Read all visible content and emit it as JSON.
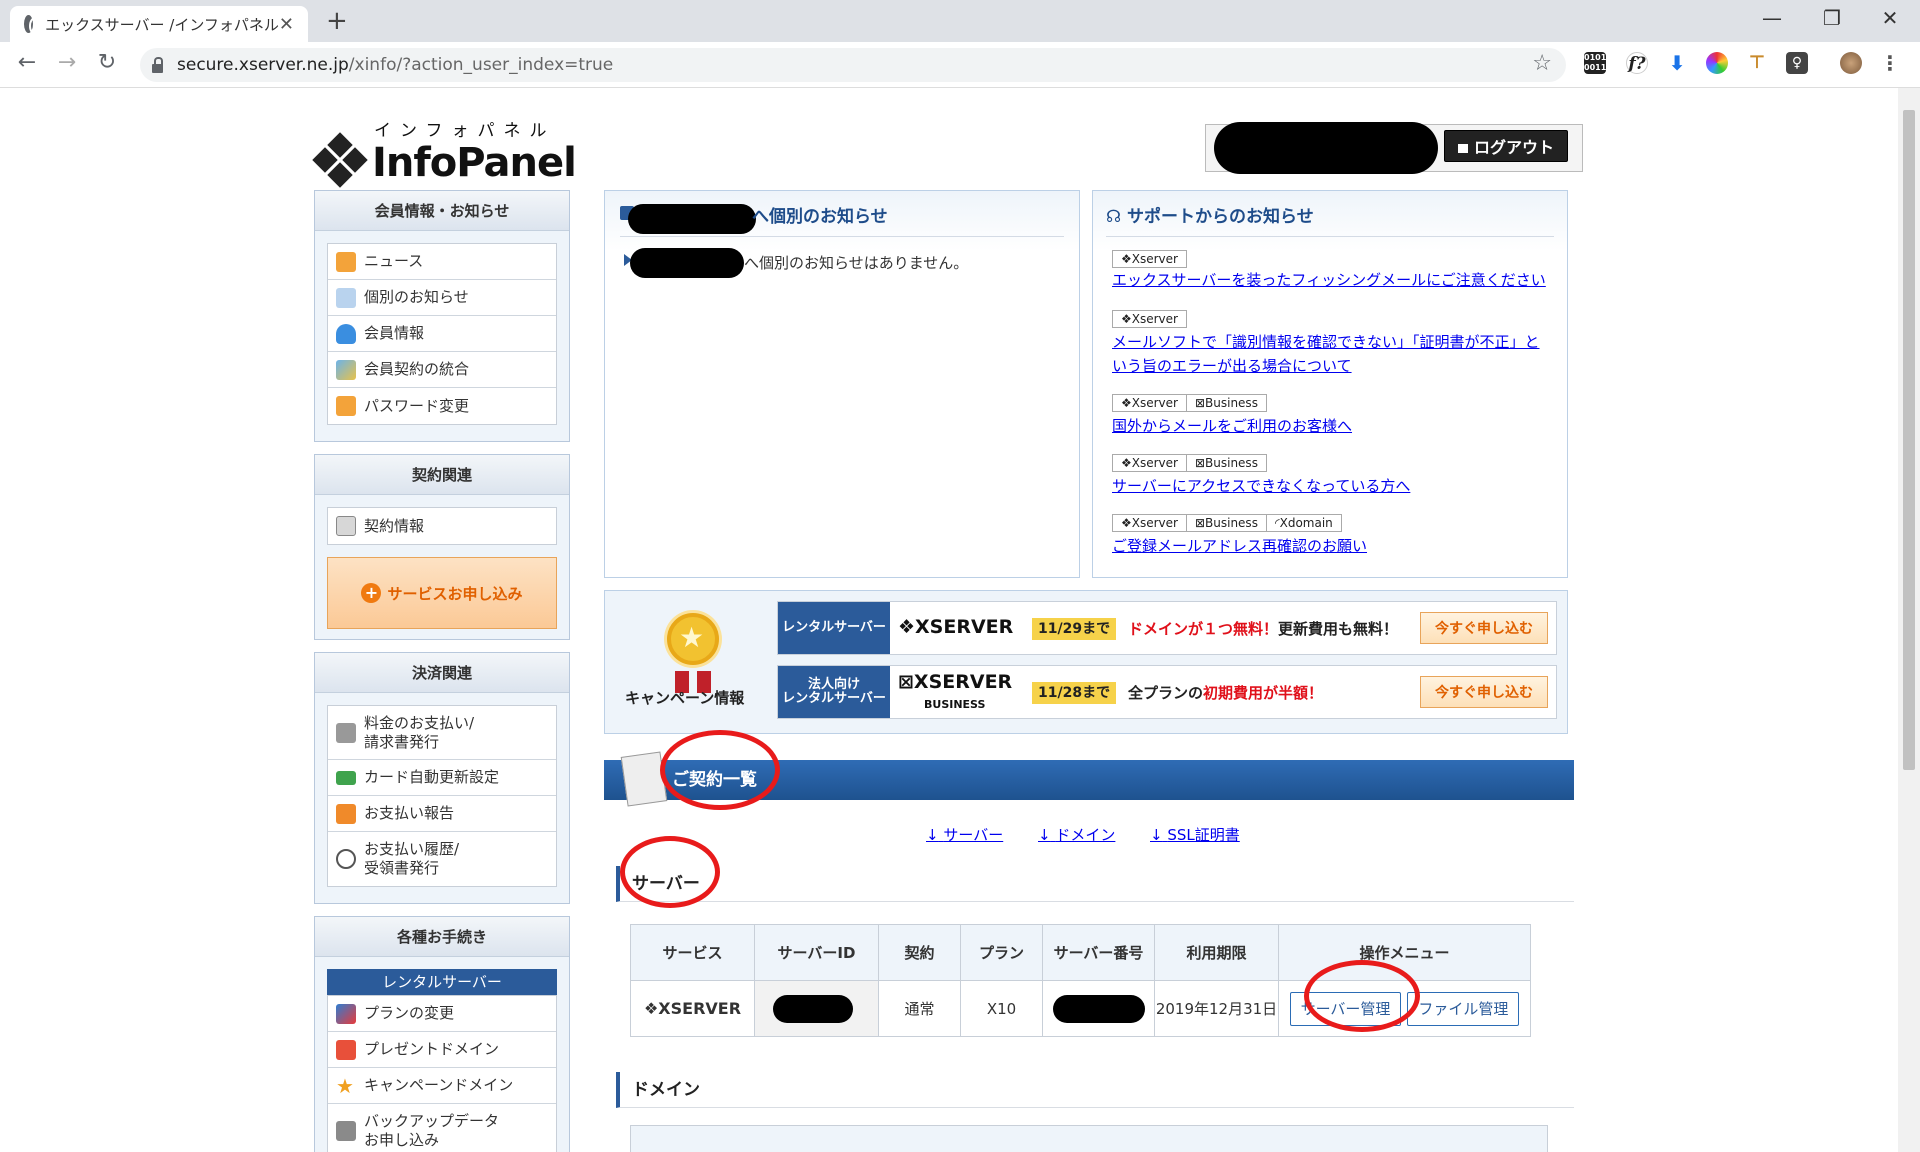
{
  "browser": {
    "tab_title": "エックスサーバー /インフォパネル",
    "tab_close": "✕",
    "new_tab": "+",
    "url_host": "secure.xserver.ne.jp",
    "url_path": "/xinfo/?action_user_index=true",
    "win_min": "—",
    "win_max": "❐",
    "win_close": "✕"
  },
  "header": {
    "logo_kana": "インフォパネル",
    "logo_text": "InfoPanel",
    "logout_label": "ログアウト"
  },
  "sidebar": {
    "member": {
      "title": "会員情報・お知らせ",
      "items": [
        "ニュース",
        "個別のお知らせ",
        "会員情報",
        "会員契約の統合",
        "パスワード変更"
      ]
    },
    "contract": {
      "title": "契約関連",
      "items": [
        "契約情報"
      ],
      "service_button": "サービスお申し込み"
    },
    "payment": {
      "title": "決済関連",
      "items": [
        "料金のお支払い/\n請求書発行",
        "カード自動更新設定",
        "お支払い報告",
        "お支払い履歴/\n受領書発行"
      ]
    },
    "procedures": {
      "title": "各種お手続き",
      "sub_header": "レンタルサーバー",
      "items": [
        "プランの変更",
        "プレゼントドメイン",
        "キャンペーンドメイン",
        "バックアップデータ\nお申し込み"
      ]
    }
  },
  "personal_notice": {
    "title": "へ個別のお知らせ",
    "text": "へ個別のお知らせはありません。"
  },
  "support_notice": {
    "title": "サポートからのお知らせ",
    "tag_xserver": "❖Xserver",
    "tag_business": "⊠Business",
    "tag_xdomain": "◜Xdomain",
    "items": [
      "エックスサーバーを装ったフィッシングメールにご注意ください",
      "メールソフトで「識別情報を確認できない」「証明書が不正」という旨のエラーが出る場合について",
      "国外からメールをご利用のお客様へ",
      "サーバーにアクセスできなくなっている方へ",
      "ご登録メールアドレス再確認のお願い"
    ]
  },
  "campaign": {
    "label": "キャンペーン情報",
    "rows": [
      {
        "badge": "レンタルサーバー",
        "logo": "❖XSERVER",
        "date": "11/29まで",
        "text_red": "ドメインが１つ無料！",
        "text_rest": "更新費用も無料！",
        "button": "今すぐ申し込む"
      },
      {
        "badge": "法人向け\nレンタルサーバー",
        "logo": "⊠XSERVER",
        "logo_sub": "BUSINESS",
        "date": "11/28まで",
        "text_pre": "全プランの",
        "text_red": "初期費用が半額！",
        "button": "今すぐ申し込む"
      }
    ]
  },
  "contracts": {
    "title": "ご契約一覧",
    "anchors": [
      "サーバー",
      "ドメイン",
      "SSL証明書"
    ],
    "anchor_arrow": "↓",
    "server_heading": "サーバー",
    "server_table": {
      "headers": [
        "サービス",
        "サーバーID",
        "契約",
        "プラン",
        "サーバー番号",
        "利用期限",
        "操作メニュー"
      ],
      "row": {
        "service": "❖XSERVER",
        "contract": "通常",
        "plan": "X10",
        "expiry": "2019年12月31日",
        "btn_manage": "サーバー管理",
        "btn_files": "ファイル管理"
      }
    },
    "domain_heading": "ドメイン"
  },
  "colors": {
    "accent_blue": "#2b5b9a",
    "link_blue": "#0000ee",
    "highlight_red": "#e81b1b",
    "campaign_orange": "#e06000"
  }
}
